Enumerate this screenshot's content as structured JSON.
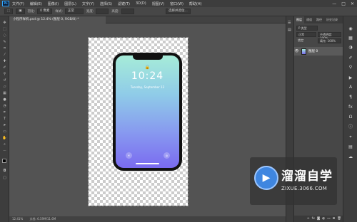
{
  "menubar": {
    "app_icon": "Ps",
    "items": [
      "文件(F)",
      "编辑(E)",
      "图像(I)",
      "图层(L)",
      "文字(Y)",
      "选择(S)",
      "滤镜(T)",
      "3D(D)",
      "视图(V)",
      "窗口(W)",
      "帮助(H)"
    ],
    "window_controls": [
      "—",
      "□",
      "✕"
    ]
  },
  "options": {
    "feather_label": "羽化:",
    "feather_value": "0 像素",
    "style_label": "样式:",
    "style_value": "正常",
    "width_label": "宽度:",
    "height_label": "高度:",
    "refine_button": "选择并遮住..."
  },
  "document": {
    "tab_title": "小程序样机.psd @ 12.4% (图层 0, RGB/8) *",
    "zoom": "12.41%",
    "doc_info": "文档: 6.59M/11.6M"
  },
  "phone_screen": {
    "time": "10:24",
    "date": "Tuesday, September 12"
  },
  "panel": {
    "tabs": [
      "图层",
      "通道",
      "路径",
      "历史记录"
    ],
    "kind_filter": "P 类型",
    "blend_mode": "正常",
    "opacity": "不透明度: 100%",
    "lock_label": "锁定:",
    "fill": "填充: 100%",
    "layer_name": "图层 0"
  },
  "watermark": {
    "brand": "溜溜自学",
    "url": "ZIXUE.3066.COM"
  },
  "colors": {
    "app_bg": "#535353",
    "screen_top": "#a6ecd8",
    "screen_bottom": "#7a6bf0",
    "watermark_logo": "#3f86e0"
  }
}
